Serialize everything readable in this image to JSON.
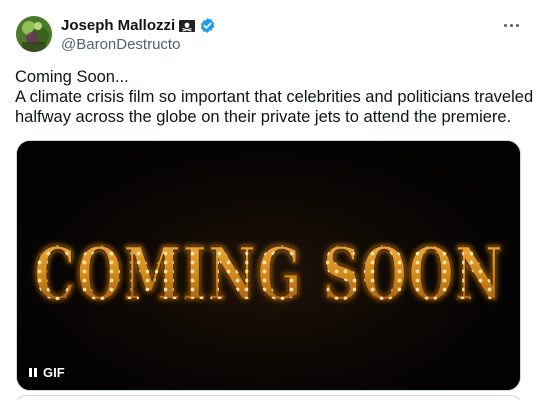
{
  "author": {
    "display_name": "Joseph Mallozzi",
    "handle": "@BaronDestructo",
    "verified": true
  },
  "tweet": {
    "text_lines": [
      "Coming Soon...",
      "A climate crisis film so important that celebrities and politicians traveled",
      "halfway across the globe on their private jets to attend the premiere."
    ]
  },
  "media": {
    "type": "gif",
    "image_text": "COMING SOON",
    "badge_label": "GIF",
    "pause_icon": "pause-icon"
  },
  "icons": {
    "flag": "pirate-flag-icon",
    "verified": "verified-badge-icon",
    "more": "more-options-icon"
  },
  "colors": {
    "verified_blue": "#1d9bf0",
    "text_primary": "#0f1419",
    "text_secondary": "#536471",
    "marquee_gold": "#e8a020",
    "bulb": "#ffe9a8"
  }
}
